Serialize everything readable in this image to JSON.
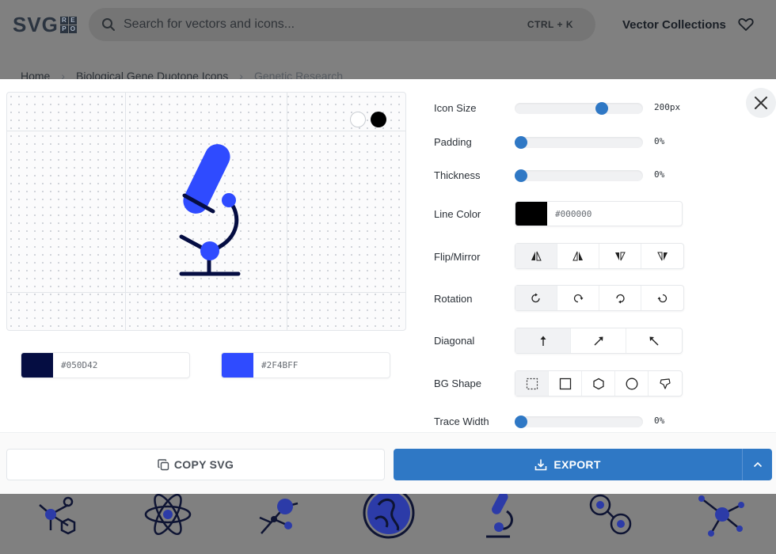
{
  "site": {
    "logo_text": "SVG",
    "logo_letters": [
      "R",
      "E",
      "P",
      "O"
    ],
    "search_placeholder": "Search for vectors and icons...",
    "search_shortcut": "CTRL + K",
    "collections_link": "Vector Collections",
    "breadcrumb": [
      "Home",
      "Biological Gene Duotone Icons",
      "Genetic Research"
    ]
  },
  "editor": {
    "colors": [
      {
        "hex": "#050D42"
      },
      {
        "hex": "#2F4BFF"
      }
    ],
    "icon_size": {
      "label": "Icon Size",
      "value": "200px",
      "fraction": 0.68
    },
    "padding": {
      "label": "Padding",
      "value": "0%",
      "fraction": 0
    },
    "thickness": {
      "label": "Thickness",
      "value": "0%",
      "fraction": 0
    },
    "line_color": {
      "label": "Line Color",
      "value": "#000000"
    },
    "flip_mirror": {
      "label": "Flip/Mirror"
    },
    "rotation": {
      "label": "Rotation"
    },
    "diagonal": {
      "label": "Diagonal"
    },
    "bg_shape": {
      "label": "BG Shape"
    },
    "trace_width": {
      "label": "Trace Width",
      "value": "0%",
      "fraction": 0
    },
    "copy_label": "COPY SVG",
    "export_label": "EXPORT"
  },
  "theme": {
    "accent": "#2F78C5",
    "icon_primary": "#2F4BFF",
    "icon_secondary": "#050D42"
  }
}
